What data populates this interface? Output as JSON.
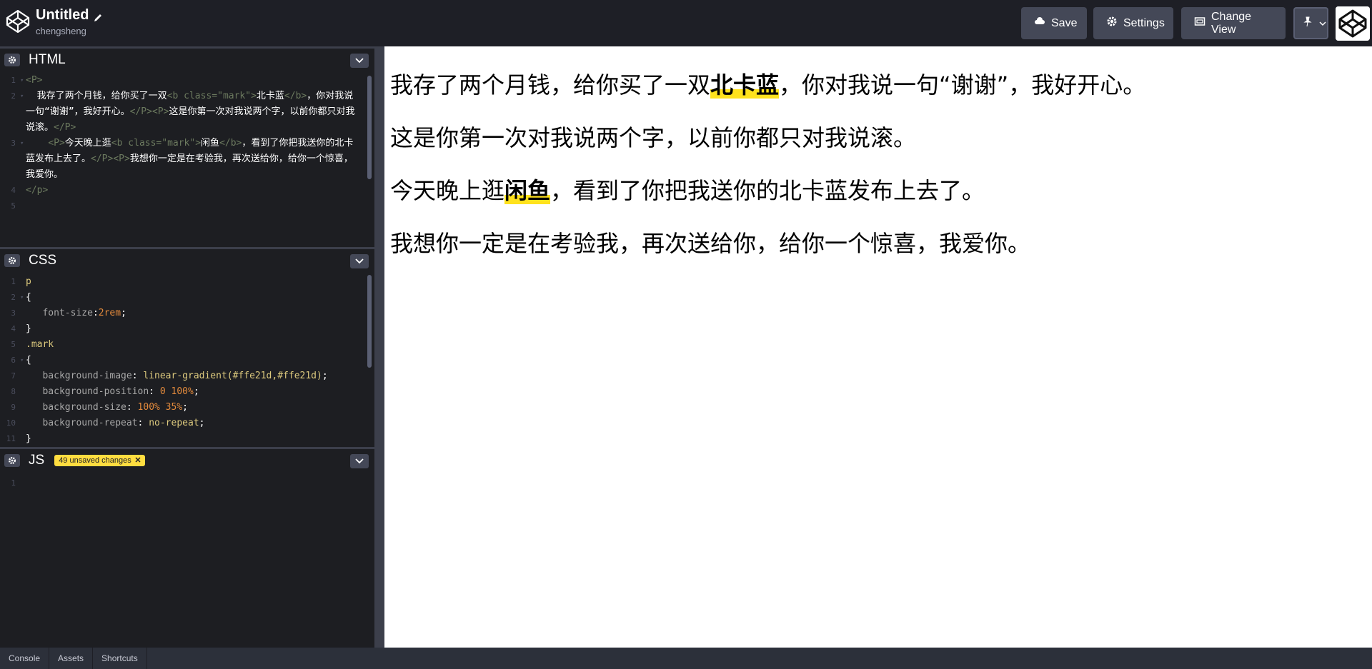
{
  "header": {
    "title": "Untitled",
    "user": "chengsheng",
    "buttons": {
      "save": "Save",
      "settings": "Settings",
      "change_view": "Change View"
    }
  },
  "panels": {
    "html": {
      "name": "HTML"
    },
    "css": {
      "name": "CSS"
    },
    "js": {
      "name": "JS",
      "badge": "49 unsaved changes"
    }
  },
  "html_code": {
    "l1": "<P>",
    "l2_indent": "  我存了两个月钱，给你买了一双",
    "l2_tag_open": "<b class=\"mark\">",
    "l2_word": "北卡蓝",
    "l2_tag_close": "</b>",
    "l2_rest": "，你对我说一句“谢谢”，我好开心。",
    "l2_p_close": "</P><P>",
    "l2_rest2": "这是你第一次对我说两个字，以前你都只对我说滚。",
    "l2_p_close2": "</P>",
    "l3_p_open": "<P>",
    "l3_text": "今天晚上逛",
    "l3_tag_open": "<b class=\"mark\">",
    "l3_word": "闲鱼",
    "l3_tag_close": "</b>",
    "l3_rest": "，看到了你把我送你的北卡蓝发布上去了。",
    "l3_p_close": "</P><P>",
    "l3_rest2": "我想你一定是在考验我，再次送给你，给你一个惊喜，我爱你。",
    "l4": "</p>"
  },
  "css_code": {
    "l1": "p",
    "l2": "{",
    "l3_prop": "font-size",
    "l3_val": "2rem",
    "l4": "}",
    "l5": ".mark",
    "l6": "{",
    "l7_prop": "background-image",
    "l7_val": "linear-gradient(#ffe21d,#ffe21d)",
    "l8_prop": "background-position",
    "l8_val": "0 100%",
    "l9_prop": "background-size",
    "l9_val": "100% 35%",
    "l10_prop": "background-repeat",
    "l10_val": "no-repeat",
    "l11": "}"
  },
  "preview": {
    "p1_before": "我存了两个月钱，给你买了一双",
    "p1_mark": "北卡蓝",
    "p1_after": "，你对我说一句“谢谢”，我好开心。",
    "p2": "这是你第一次对我说两个字，以前你都只对我说滚。",
    "p3_before": "今天晚上逛",
    "p3_mark": "闲鱼",
    "p3_after": "，看到了你把我送你的北卡蓝发布上去了。",
    "p4": "我想你一定是在考验我，再次送给你，给你一个惊喜，我爱你。"
  },
  "footer": {
    "console": "Console",
    "assets": "Assets",
    "shortcuts": "Shortcuts"
  },
  "colors": {
    "mark": "#ffe21d",
    "badge": "#ffdd40",
    "button": "#444857"
  }
}
